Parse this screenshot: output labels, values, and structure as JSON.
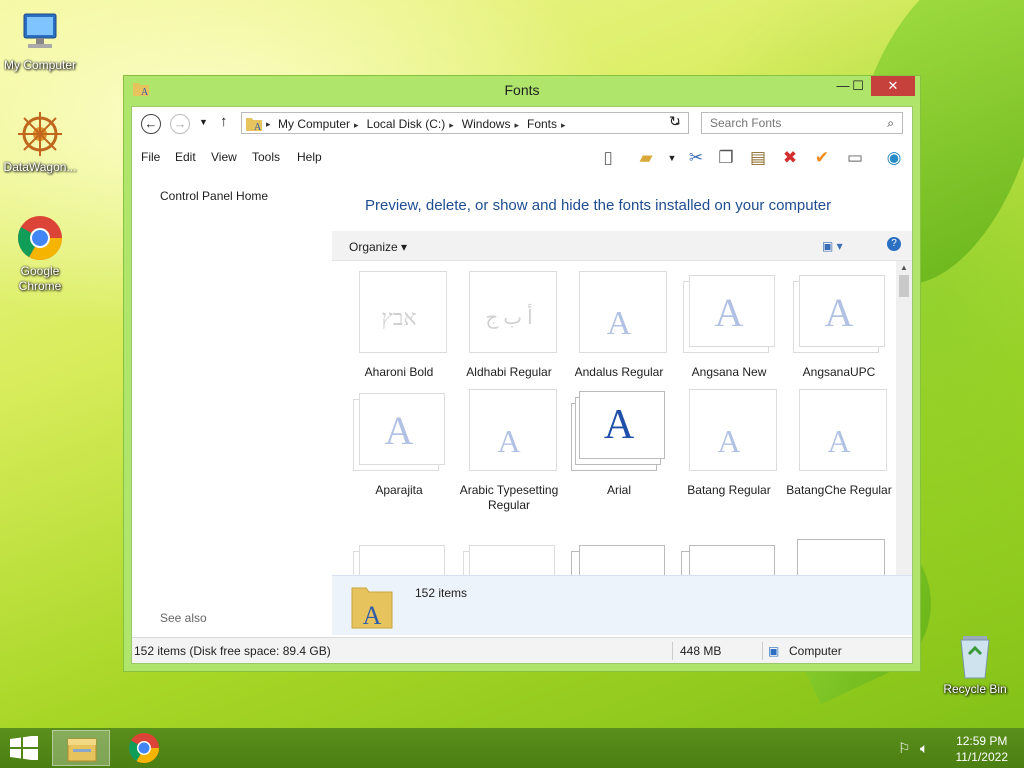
{
  "desktop": {
    "icons": [
      {
        "label": "My Computer"
      },
      {
        "label": "DataWagon..."
      },
      {
        "label": "Google Chrome"
      },
      {
        "label": "Recycle Bin"
      }
    ]
  },
  "window": {
    "title": "Fonts",
    "buttons": {
      "minimize": "—",
      "maximize": "☐",
      "close": "✕"
    },
    "address": {
      "crumbs": [
        "My Computer",
        "Local Disk (C:)",
        "Windows",
        "Fonts"
      ]
    },
    "search": {
      "placeholder": "Search Fonts"
    },
    "menu": [
      "File",
      "Edit",
      "View",
      "Tools",
      "Help"
    ],
    "left_pane": {
      "home": "Control Panel Home",
      "see_also": "See also"
    },
    "heading": "Preview, delete, or show and hide the fonts installed on your computer",
    "organize": "Organize ▾",
    "fonts": [
      {
        "name": "Aharoni Bold",
        "glyph": "אבץ",
        "style": "single",
        "faded": true
      },
      {
        "name": "Aldhabi Regular",
        "glyph": "أ ب ج",
        "style": "single",
        "faded": true
      },
      {
        "name": "Andalus Regular",
        "glyph": "A",
        "style": "single",
        "faded": true
      },
      {
        "name": "Angsana New",
        "glyph": "A",
        "style": "stack",
        "faded": true
      },
      {
        "name": "AngsanaUPC",
        "glyph": "A",
        "style": "stack",
        "faded": true
      },
      {
        "name": "Aparajita",
        "glyph": "A",
        "style": "stack",
        "faded": true
      },
      {
        "name": "Arabic Typesetting Regular",
        "glyph": "A",
        "style": "single",
        "faded": true
      },
      {
        "name": "Arial",
        "glyph": "A",
        "style": "stack",
        "faded": false
      },
      {
        "name": "Batang Regular",
        "glyph": "A",
        "style": "single",
        "faded": true
      },
      {
        "name": "BatangChe Regular",
        "glyph": "A",
        "style": "single",
        "faded": true
      }
    ],
    "details": {
      "count": "152 items"
    },
    "status": {
      "items": "152 items (Disk free space: 89.4 GB)",
      "size": "448 MB",
      "location": "Computer"
    }
  },
  "taskbar": {
    "time": "12:59 PM",
    "date": "11/1/2022"
  }
}
